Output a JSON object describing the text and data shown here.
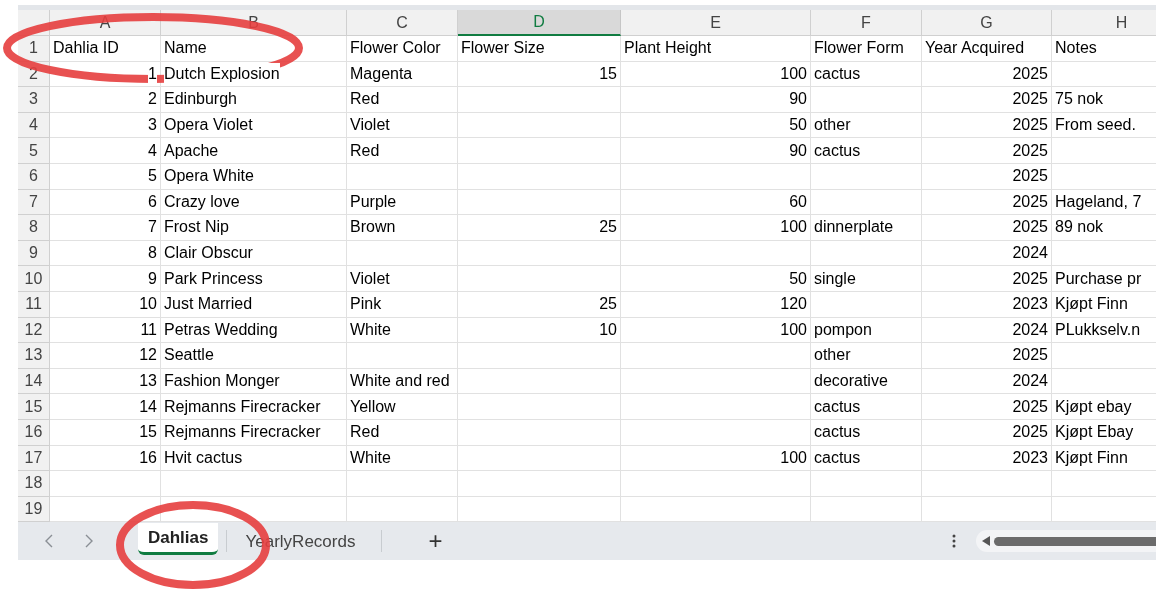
{
  "columns": [
    {
      "letter": "A",
      "numeric": true,
      "selected": false
    },
    {
      "letter": "B",
      "numeric": false,
      "selected": false
    },
    {
      "letter": "C",
      "numeric": false,
      "selected": false
    },
    {
      "letter": "D",
      "numeric": true,
      "selected": true
    },
    {
      "letter": "E",
      "numeric": true,
      "selected": false
    },
    {
      "letter": "F",
      "numeric": false,
      "selected": false
    },
    {
      "letter": "G",
      "numeric": true,
      "selected": false
    },
    {
      "letter": "H",
      "numeric": false,
      "selected": false
    }
  ],
  "header_row": {
    "number": "1",
    "cells": [
      "Dahlia ID",
      "Name",
      "Flower Color",
      "Flower Size",
      "Plant Height",
      "Flower Form",
      "Year Acquired",
      "Notes"
    ]
  },
  "rows": [
    {
      "number": "2",
      "cells": [
        "1",
        "Dutch Explosion",
        "Magenta",
        "15",
        "100",
        "cactus",
        "2025",
        null
      ]
    },
    {
      "number": "3",
      "cells": [
        "2",
        "Edinburgh",
        "Red",
        null,
        "90",
        null,
        "2025",
        "75 nok"
      ]
    },
    {
      "number": "4",
      "cells": [
        "3",
        "Opera Violet",
        "Violet",
        null,
        "50",
        "other",
        "2025",
        "From seed."
      ]
    },
    {
      "number": "5",
      "cells": [
        "4",
        "Apache",
        "Red",
        null,
        "90",
        "cactus",
        "2025",
        null
      ]
    },
    {
      "number": "6",
      "cells": [
        "5",
        "Opera White",
        null,
        null,
        null,
        null,
        "2025",
        null
      ]
    },
    {
      "number": "7",
      "cells": [
        "6",
        "Crazy love",
        "Purple",
        null,
        "60",
        null,
        "2025",
        "Hageland, 7"
      ]
    },
    {
      "number": "8",
      "cells": [
        "7",
        "Frost Nip",
        "Brown",
        "25",
        "100",
        "dinnerplate",
        "2025",
        "89 nok"
      ]
    },
    {
      "number": "9",
      "cells": [
        "8",
        "Clair Obscur",
        null,
        null,
        null,
        null,
        "2024",
        null
      ]
    },
    {
      "number": "10",
      "cells": [
        "9",
        "Park Princess",
        "Violet",
        null,
        "50",
        "single",
        "2025",
        "Purchase pr"
      ]
    },
    {
      "number": "11",
      "cells": [
        "10",
        "Just Married",
        "Pink",
        "25",
        "120",
        null,
        "2023",
        "Kjøpt  Finn"
      ]
    },
    {
      "number": "12",
      "cells": [
        "11",
        "Petras Wedding",
        "White",
        "10",
        "100",
        "pompon",
        "2024",
        "PLukkselv.n"
      ]
    },
    {
      "number": "13",
      "cells": [
        "12",
        "Seattle",
        null,
        null,
        null,
        "other",
        "2025",
        null
      ]
    },
    {
      "number": "14",
      "cells": [
        "13",
        "Fashion Monger",
        "White and red",
        null,
        null,
        "decorative",
        "2024",
        null
      ]
    },
    {
      "number": "15",
      "cells": [
        "14",
        "Rejmanns Firecracker",
        "Yellow",
        null,
        null,
        "cactus",
        "2025",
        "Kjøpt ebay"
      ]
    },
    {
      "number": "16",
      "cells": [
        "15",
        "Rejmanns Firecracker",
        "Red",
        null,
        null,
        "cactus",
        "2025",
        "Kjøpt Ebay"
      ]
    },
    {
      "number": "17",
      "cells": [
        "16",
        "Hvit cactus",
        "White",
        null,
        "100",
        "cactus",
        "2023",
        "Kjøpt Finn"
      ]
    },
    {
      "number": "18",
      "cells": [
        null,
        null,
        null,
        null,
        null,
        null,
        null,
        null
      ]
    },
    {
      "number": "19",
      "cells": [
        null,
        null,
        null,
        null,
        null,
        null,
        null,
        null
      ]
    }
  ],
  "sheet_tabs": [
    {
      "label": "Dahlias",
      "selected": true
    },
    {
      "label": "YearlyRecords",
      "selected": false
    }
  ],
  "add_sheet": "+",
  "annotations": [
    {
      "kind": "ellipse"
    },
    {
      "kind": "ellipse"
    }
  ]
}
